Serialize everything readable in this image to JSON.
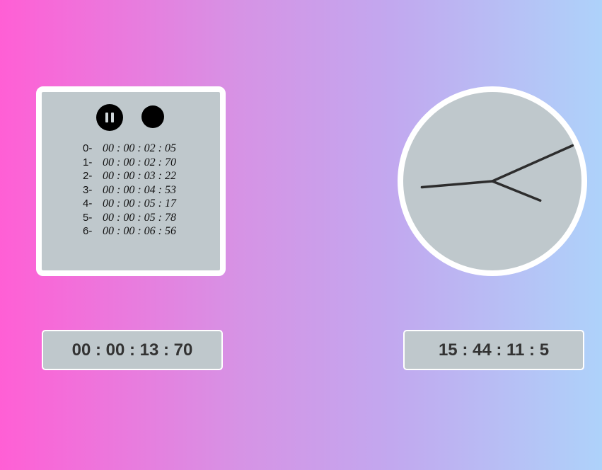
{
  "stopwatch": {
    "laps": [
      {
        "index": "0-",
        "time": "00 : 00 : 02 : 05"
      },
      {
        "index": "1-",
        "time": "00 : 00 : 02 : 70"
      },
      {
        "index": "2-",
        "time": "00 : 00 : 03 : 22"
      },
      {
        "index": "3-",
        "time": "00 : 00 : 04 : 53"
      },
      {
        "index": "4-",
        "time": "00 : 00 : 05 : 17"
      },
      {
        "index": "5-",
        "time": "00 : 00 : 05 : 78"
      },
      {
        "index": "6-",
        "time": "00 : 00 : 06 : 56"
      }
    ],
    "display": "00 : 00 : 13 : 70",
    "controls": {
      "pause_icon": "pause-icon",
      "stop_icon": "stop-icon"
    }
  },
  "clock": {
    "display": "15 : 44 : 11 : 5",
    "hour": 15,
    "minute": 44,
    "second": 11,
    "hand_color": "#2d2d2d",
    "face_color": "#bfc8cc"
  }
}
